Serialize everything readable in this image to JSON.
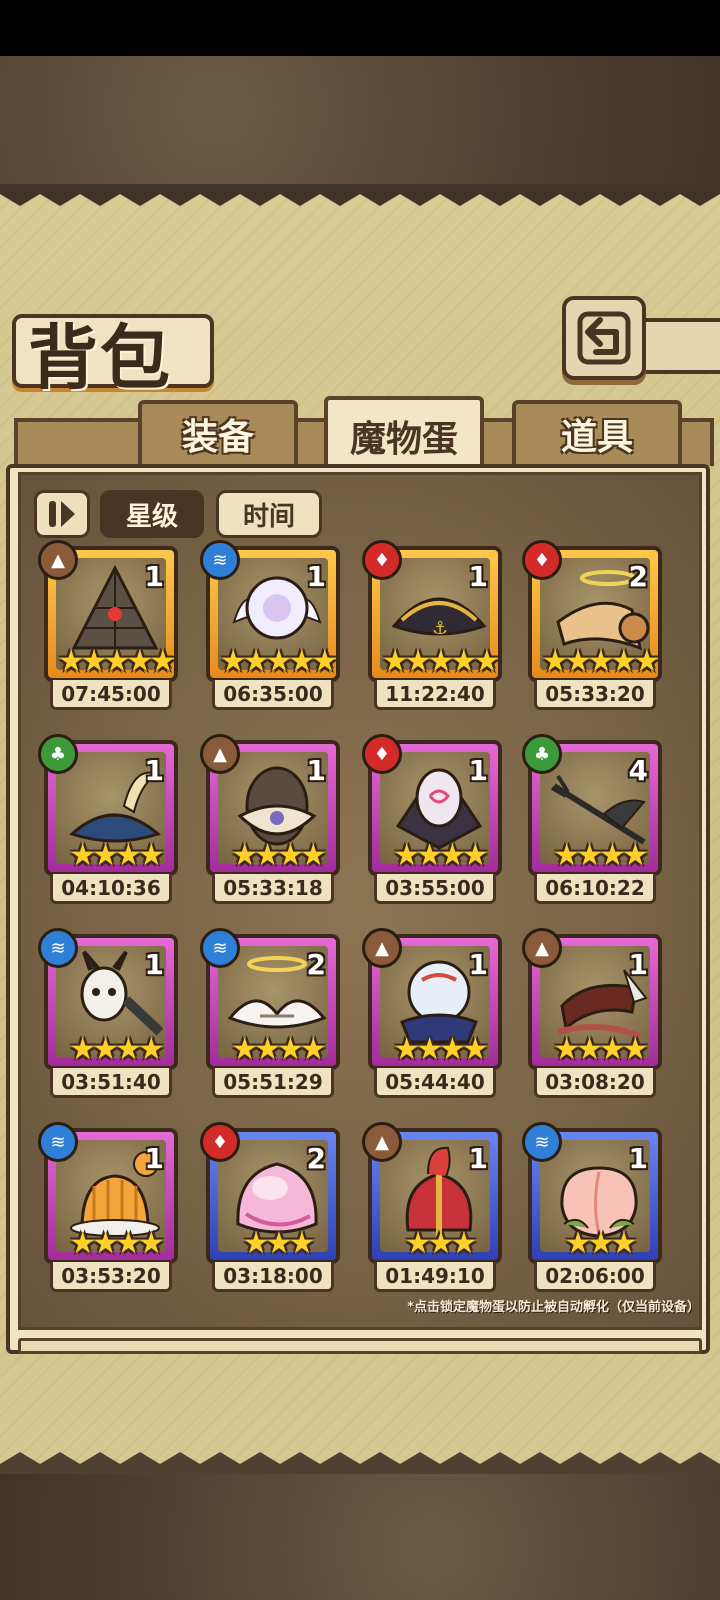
{
  "header": {
    "title": "背包",
    "back_icon": "back-arrow-icon"
  },
  "tabs": [
    {
      "label": "装备",
      "active": false
    },
    {
      "label": "魔物蛋",
      "active": true
    },
    {
      "label": "道具",
      "active": false
    }
  ],
  "sort": {
    "icon": "sort-order-icon",
    "star_label": "星级",
    "time_label": "时间",
    "selected": "星级"
  },
  "eggs": [
    {
      "name": "pyramid",
      "element": "earth",
      "count": "1",
      "stars": "★★★★★",
      "timer": "07:45:00",
      "rarity": "gold"
    },
    {
      "name": "winged-pearl",
      "element": "water",
      "count": "1",
      "stars": "★★★★★",
      "timer": "06:35:00",
      "rarity": "gold"
    },
    {
      "name": "pirate-hat",
      "element": "fire",
      "count": "1",
      "stars": "★★★★★",
      "timer": "11:22:40",
      "rarity": "gold"
    },
    {
      "name": "angel-horn",
      "element": "fire",
      "count": "2",
      "stars": "★★★★★",
      "timer": "05:33:20",
      "rarity": "gold"
    },
    {
      "name": "feathered-hat",
      "element": "leaf",
      "count": "1",
      "stars": "★★★★",
      "timer": "04:10:36",
      "rarity": "purple"
    },
    {
      "name": "veiled-egg",
      "element": "earth",
      "count": "1",
      "stars": "★★★★",
      "timer": "05:33:18",
      "rarity": "purple"
    },
    {
      "name": "bat-mask",
      "element": "fire",
      "count": "1",
      "stars": "★★★★",
      "timer": "03:55:00",
      "rarity": "purple"
    },
    {
      "name": "devil-trident",
      "element": "leaf",
      "count": "4",
      "stars": "★★★★",
      "timer": "06:10:22",
      "rarity": "purple"
    },
    {
      "name": "bunny-doll",
      "element": "water",
      "count": "1",
      "stars": "★★★★",
      "timer": "03:51:40",
      "rarity": "purple"
    },
    {
      "name": "halo-wings",
      "element": "water",
      "count": "2",
      "stars": "★★★★",
      "timer": "05:51:29",
      "rarity": "purple"
    },
    {
      "name": "crystal-ball",
      "element": "earth",
      "count": "1",
      "stars": "★★★★",
      "timer": "05:44:40",
      "rarity": "purple"
    },
    {
      "name": "scroll-blade",
      "element": "earth",
      "count": "1",
      "stars": "★★★★",
      "timer": "03:08:20",
      "rarity": "purple"
    },
    {
      "name": "pudding",
      "element": "water",
      "count": "1",
      "stars": "★★★★",
      "timer": "03:53:20",
      "rarity": "purple"
    },
    {
      "name": "pink-slime",
      "element": "fire",
      "count": "2",
      "stars": "★★★",
      "timer": "03:18:00",
      "rarity": "blue"
    },
    {
      "name": "plume-helmet",
      "element": "earth",
      "count": "1",
      "stars": "★★★",
      "timer": "01:49:10",
      "rarity": "blue"
    },
    {
      "name": "peach",
      "element": "water",
      "count": "1",
      "stars": "★★★",
      "timer": "02:06:00",
      "rarity": "blue"
    }
  ],
  "note": "*点击锁定魔物蛋以防止被自动孵化（仅当前设备）",
  "colors": {
    "gold": "#f5a623",
    "purple": "#c545b9",
    "blue": "#4a5fd6",
    "earth": "#8a5b3a",
    "water": "#2f7fd6",
    "fire": "#d32a2a",
    "leaf": "#3d9a3a"
  }
}
